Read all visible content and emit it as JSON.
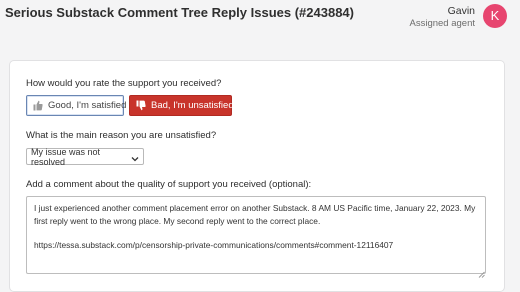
{
  "header": {
    "title": "Serious Substack Comment Tree Reply Issues (#243884)",
    "agent_name": "Gavin",
    "agent_role": "Assigned agent",
    "avatar_letter": "K"
  },
  "colors": {
    "avatar": "#e7456f",
    "unsatisfied_button": "#c8342b",
    "selected_outline": "#6a86b3"
  },
  "rating": {
    "question": "How would you rate the support you received?",
    "good_label": "Good, I'm satisfied",
    "bad_label": "Bad, I'm unsatisfied",
    "good_icon": "thumbs-up-icon",
    "bad_icon": "thumbs-down-icon"
  },
  "reason": {
    "question": "What is the main reason you are unsatisfied?",
    "selected": "My issue was not resolved"
  },
  "comment": {
    "question": "Add a comment about the quality of support you received (optional):",
    "line1": "I just experienced another comment placement error on another Substack. 8 AM US Pacific time, January 22, 2023. My first reply went to the wrong place. My second reply went to the correct place.",
    "line2": "https://tessa.substack.com/p/censorship-private-communications/comments#comment-12116407"
  }
}
